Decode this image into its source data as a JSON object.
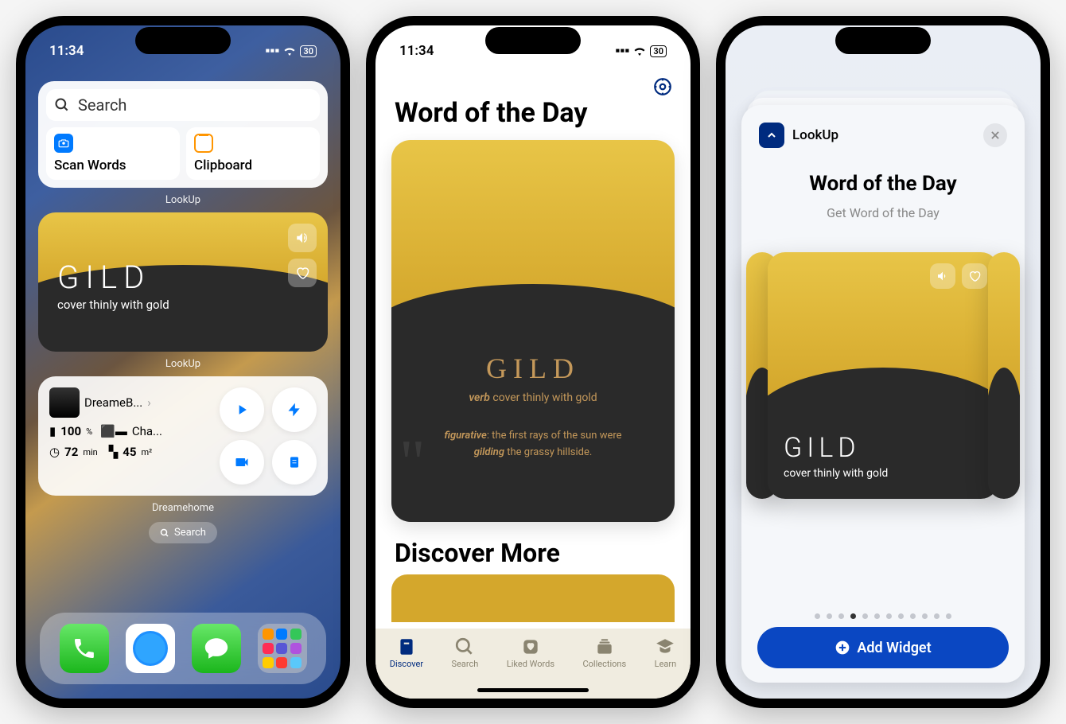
{
  "status": {
    "time": "11:34",
    "battery": "30"
  },
  "phone1": {
    "search": {
      "placeholder": "Search",
      "scan": "Scan Words",
      "clipboard": "Clipboard"
    },
    "label1": "LookUp",
    "gild": {
      "word": "GILD",
      "def": "cover thinly with gold"
    },
    "label2": "LookUp",
    "dreame": {
      "name": "DreameB...",
      "batt": "100",
      "battUnit": "%",
      "status": "Cha...",
      "time": "72",
      "timeUnit": "min",
      "area": "45",
      "areaUnit": "m²"
    },
    "label3": "Dreamehome",
    "spotlight": "Search"
  },
  "phone2": {
    "heading": "Word of the Day",
    "card": {
      "word": "GILD",
      "pos": "verb",
      "def": "cover thinly with gold",
      "example1_prefix": "figurative",
      "example1": ": the first rays of the sun were",
      "example2_em": "gilding",
      "example2": " the grassy hillside."
    },
    "discover": "Discover More",
    "tabs": [
      "Discover",
      "Search",
      "Liked Words",
      "Collections",
      "Learn"
    ]
  },
  "phone3": {
    "app": "LookUp",
    "title": "Word of the Day",
    "subtitle": "Get Word of the Day",
    "widget": {
      "word": "GILD",
      "def": "cover thinly with gold"
    },
    "add": "Add Widget",
    "dots": 12,
    "active_dot": 3
  }
}
